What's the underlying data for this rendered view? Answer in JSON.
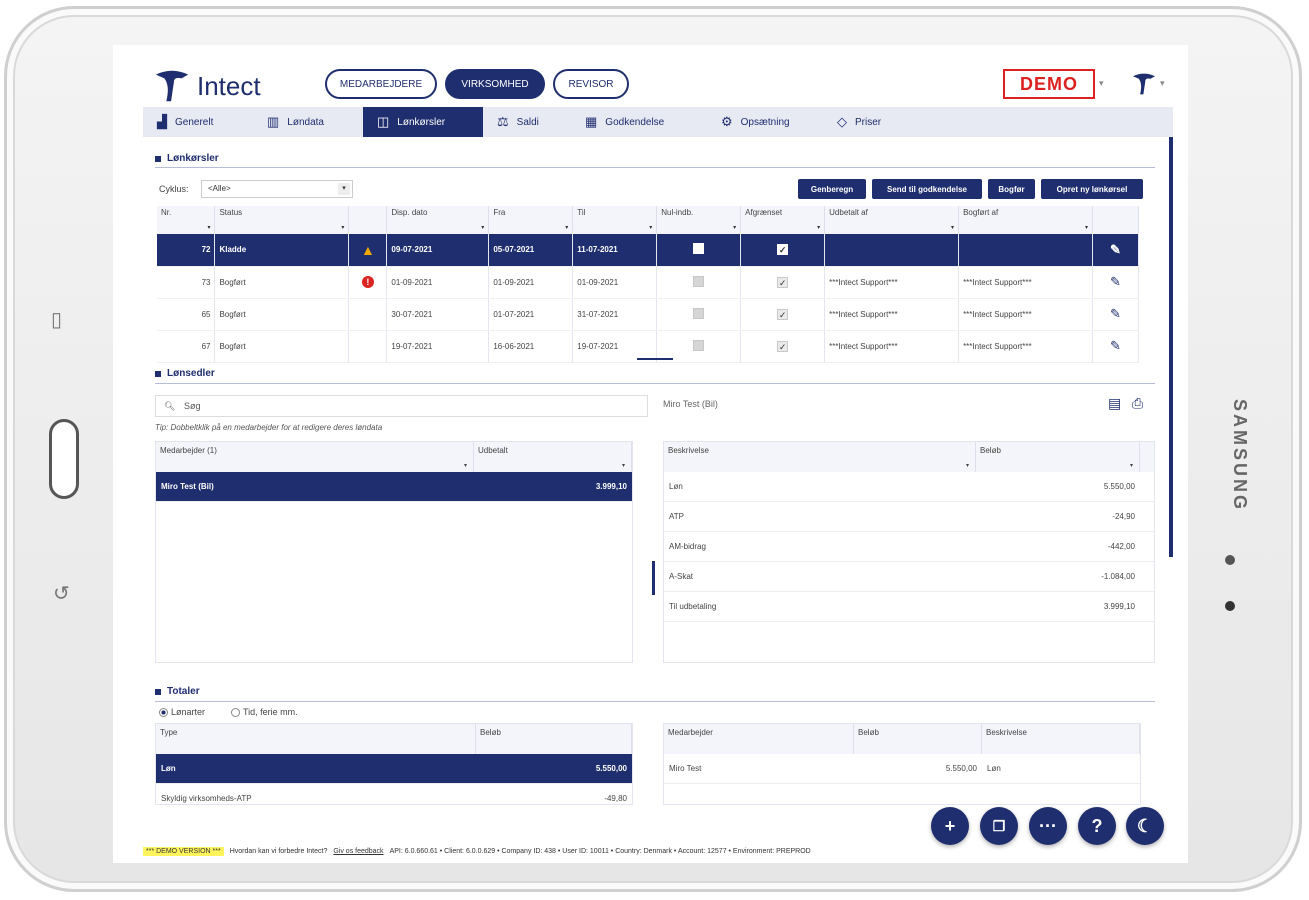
{
  "device": {
    "brand": "SAMSUNG"
  },
  "header": {
    "logo_text": "Intect",
    "roles": [
      "MEDARBEJDERE",
      "VIRKSOMHED",
      "REVISOR"
    ],
    "demo_badge": "DEMO"
  },
  "nav": {
    "tabs": [
      {
        "label": "Generelt",
        "icon": "chart-icon"
      },
      {
        "label": "Løndata",
        "icon": "columns-icon"
      },
      {
        "label": "Lønkørsler",
        "icon": "panel-icon"
      },
      {
        "label": "Saldi",
        "icon": "scale-icon"
      },
      {
        "label": "Godkendelse",
        "icon": "calendar-icon"
      },
      {
        "label": "Opsætning",
        "icon": "gear-icon"
      },
      {
        "label": "Priser",
        "icon": "diamond-icon"
      }
    ]
  },
  "payruns": {
    "title": "Lønkørsler",
    "cycle_label": "Cyklus:",
    "cycle_value": "<Alle>",
    "buttons": [
      "Genberegn",
      "Send til godkendelse",
      "Bogfør",
      "Opret ny lønkørsel"
    ],
    "columns": [
      "Nr.",
      "Status",
      "",
      "Disp. dato",
      "Fra",
      "Til",
      "Nul-indb.",
      "Afgrænset",
      "Udbetalt af",
      "Bogført af",
      ""
    ],
    "rows": [
      {
        "nr": "72",
        "status": "Kladde",
        "flag": "warn",
        "disp": "09-07-2021",
        "from": "05-07-2021",
        "to": "11-07-2021",
        "paid_by": "",
        "posted_by": ""
      },
      {
        "nr": "73",
        "status": "Bogført",
        "flag": "error",
        "disp": "01-09-2021",
        "from": "01-09-2021",
        "to": "01-09-2021",
        "paid_by": "***Intect Support***",
        "posted_by": "***Intect Support***"
      },
      {
        "nr": "65",
        "status": "Bogført",
        "flag": "",
        "disp": "30-07-2021",
        "from": "01-07-2021",
        "to": "31-07-2021",
        "paid_by": "***Intect Support***",
        "posted_by": "***Intect Support***"
      },
      {
        "nr": "67",
        "status": "Bogført",
        "flag": "",
        "disp": "19-07-2021",
        "from": "16-06-2021",
        "to": "19-07-2021",
        "paid_by": "***Intect Support***",
        "posted_by": "***Intect Support***"
      }
    ]
  },
  "payslips": {
    "title": "Lønsedler",
    "search_placeholder": "Søg",
    "hint": "Tip: Dobbeltklik på en medarbejder for at redigere deres løndata",
    "employee_heading": "Miro Test (Bil)",
    "emp_columns": [
      "Medarbejder (1)",
      "Udbetalt"
    ],
    "emp_rows": [
      {
        "name": "Miro Test (Bil)",
        "amount": "3.999,10"
      }
    ],
    "line_columns": [
      "Beskrivelse",
      "Beløb"
    ],
    "lines": [
      {
        "desc": "Løn",
        "amount": "5.550,00"
      },
      {
        "desc": "ATP",
        "amount": "-24,90"
      },
      {
        "desc": "AM-bidrag",
        "amount": "-442,00"
      },
      {
        "desc": "A-Skat",
        "amount": "-1.084,00"
      },
      {
        "desc": "Til udbetaling",
        "amount": "3.999,10"
      }
    ]
  },
  "totals": {
    "title": "Totaler",
    "radio1": "Lønarter",
    "radio2": "Tid, ferie mm.",
    "left_columns": [
      "Type",
      "Beløb"
    ],
    "left_rows": [
      {
        "type": "Løn",
        "amount": "5.550,00"
      },
      {
        "type": "Skyldig virksomheds-ATP",
        "amount": "-49,80"
      }
    ],
    "right_columns": [
      "Medarbejder",
      "Beløb",
      "Beskrivelse"
    ],
    "right_rows": [
      {
        "employee": "Miro Test",
        "amount": "5.550,00",
        "desc": "Løn"
      }
    ]
  },
  "footer": {
    "demo": "*** DEMO VERSION ***",
    "question": "Hvordan kan vi forbedre Intect?",
    "feedback": "Giv os feedback",
    "info": "API: 6.0.660.61 • Client: 6.0.0.629 • Company ID: 438 • User ID: 10011 • Country: Denmark • Account: 12577 • Environment: PREPROD"
  },
  "fabs": [
    "+",
    "pages-icon",
    "more-icon",
    "?",
    "moon-icon"
  ]
}
